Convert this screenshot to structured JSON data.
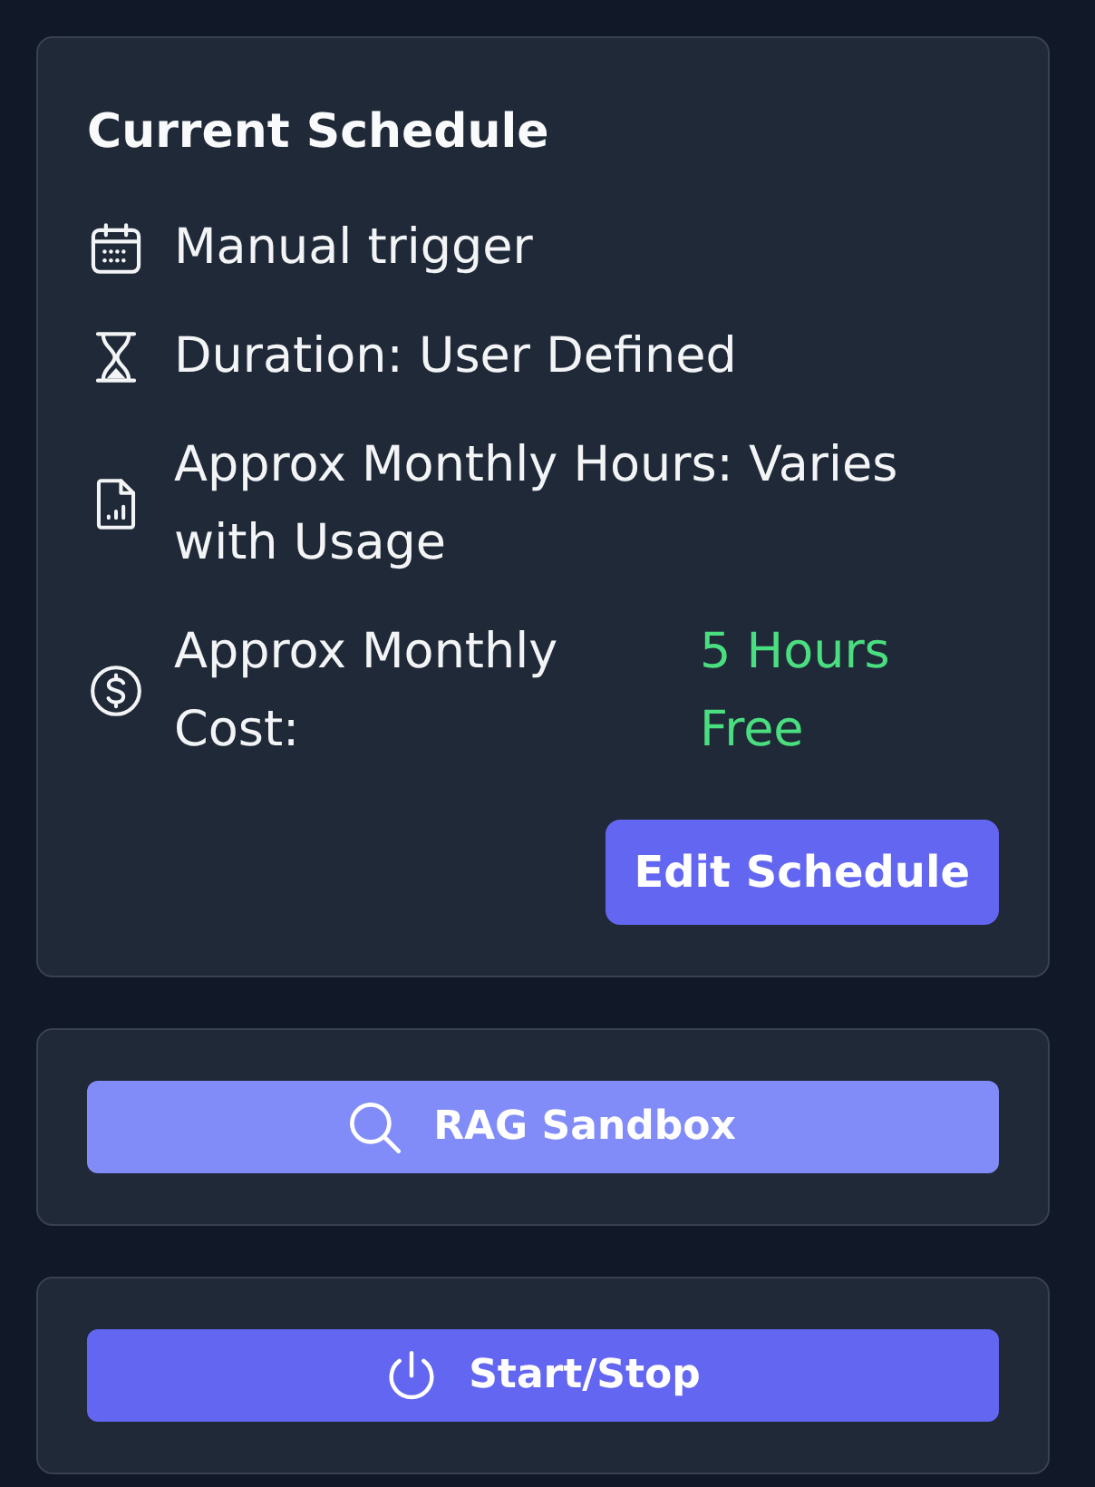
{
  "schedule": {
    "title": "Current Schedule",
    "items": [
      {
        "kind": "text",
        "text": "Manual trigger"
      },
      {
        "kind": "text",
        "text": "Duration: User Defined"
      },
      {
        "kind": "text",
        "text": "Approx Monthly Hours: Varies with Usage"
      },
      {
        "kind": "pair",
        "label": "Approx Monthly Cost:",
        "value": "5 Hours Free"
      }
    ],
    "edit_button": "Edit Schedule"
  },
  "actions": [
    {
      "label": "RAG Sandbox",
      "color": "#818cf8"
    },
    {
      "label": "Start/Stop",
      "color": "#6366f1"
    }
  ]
}
